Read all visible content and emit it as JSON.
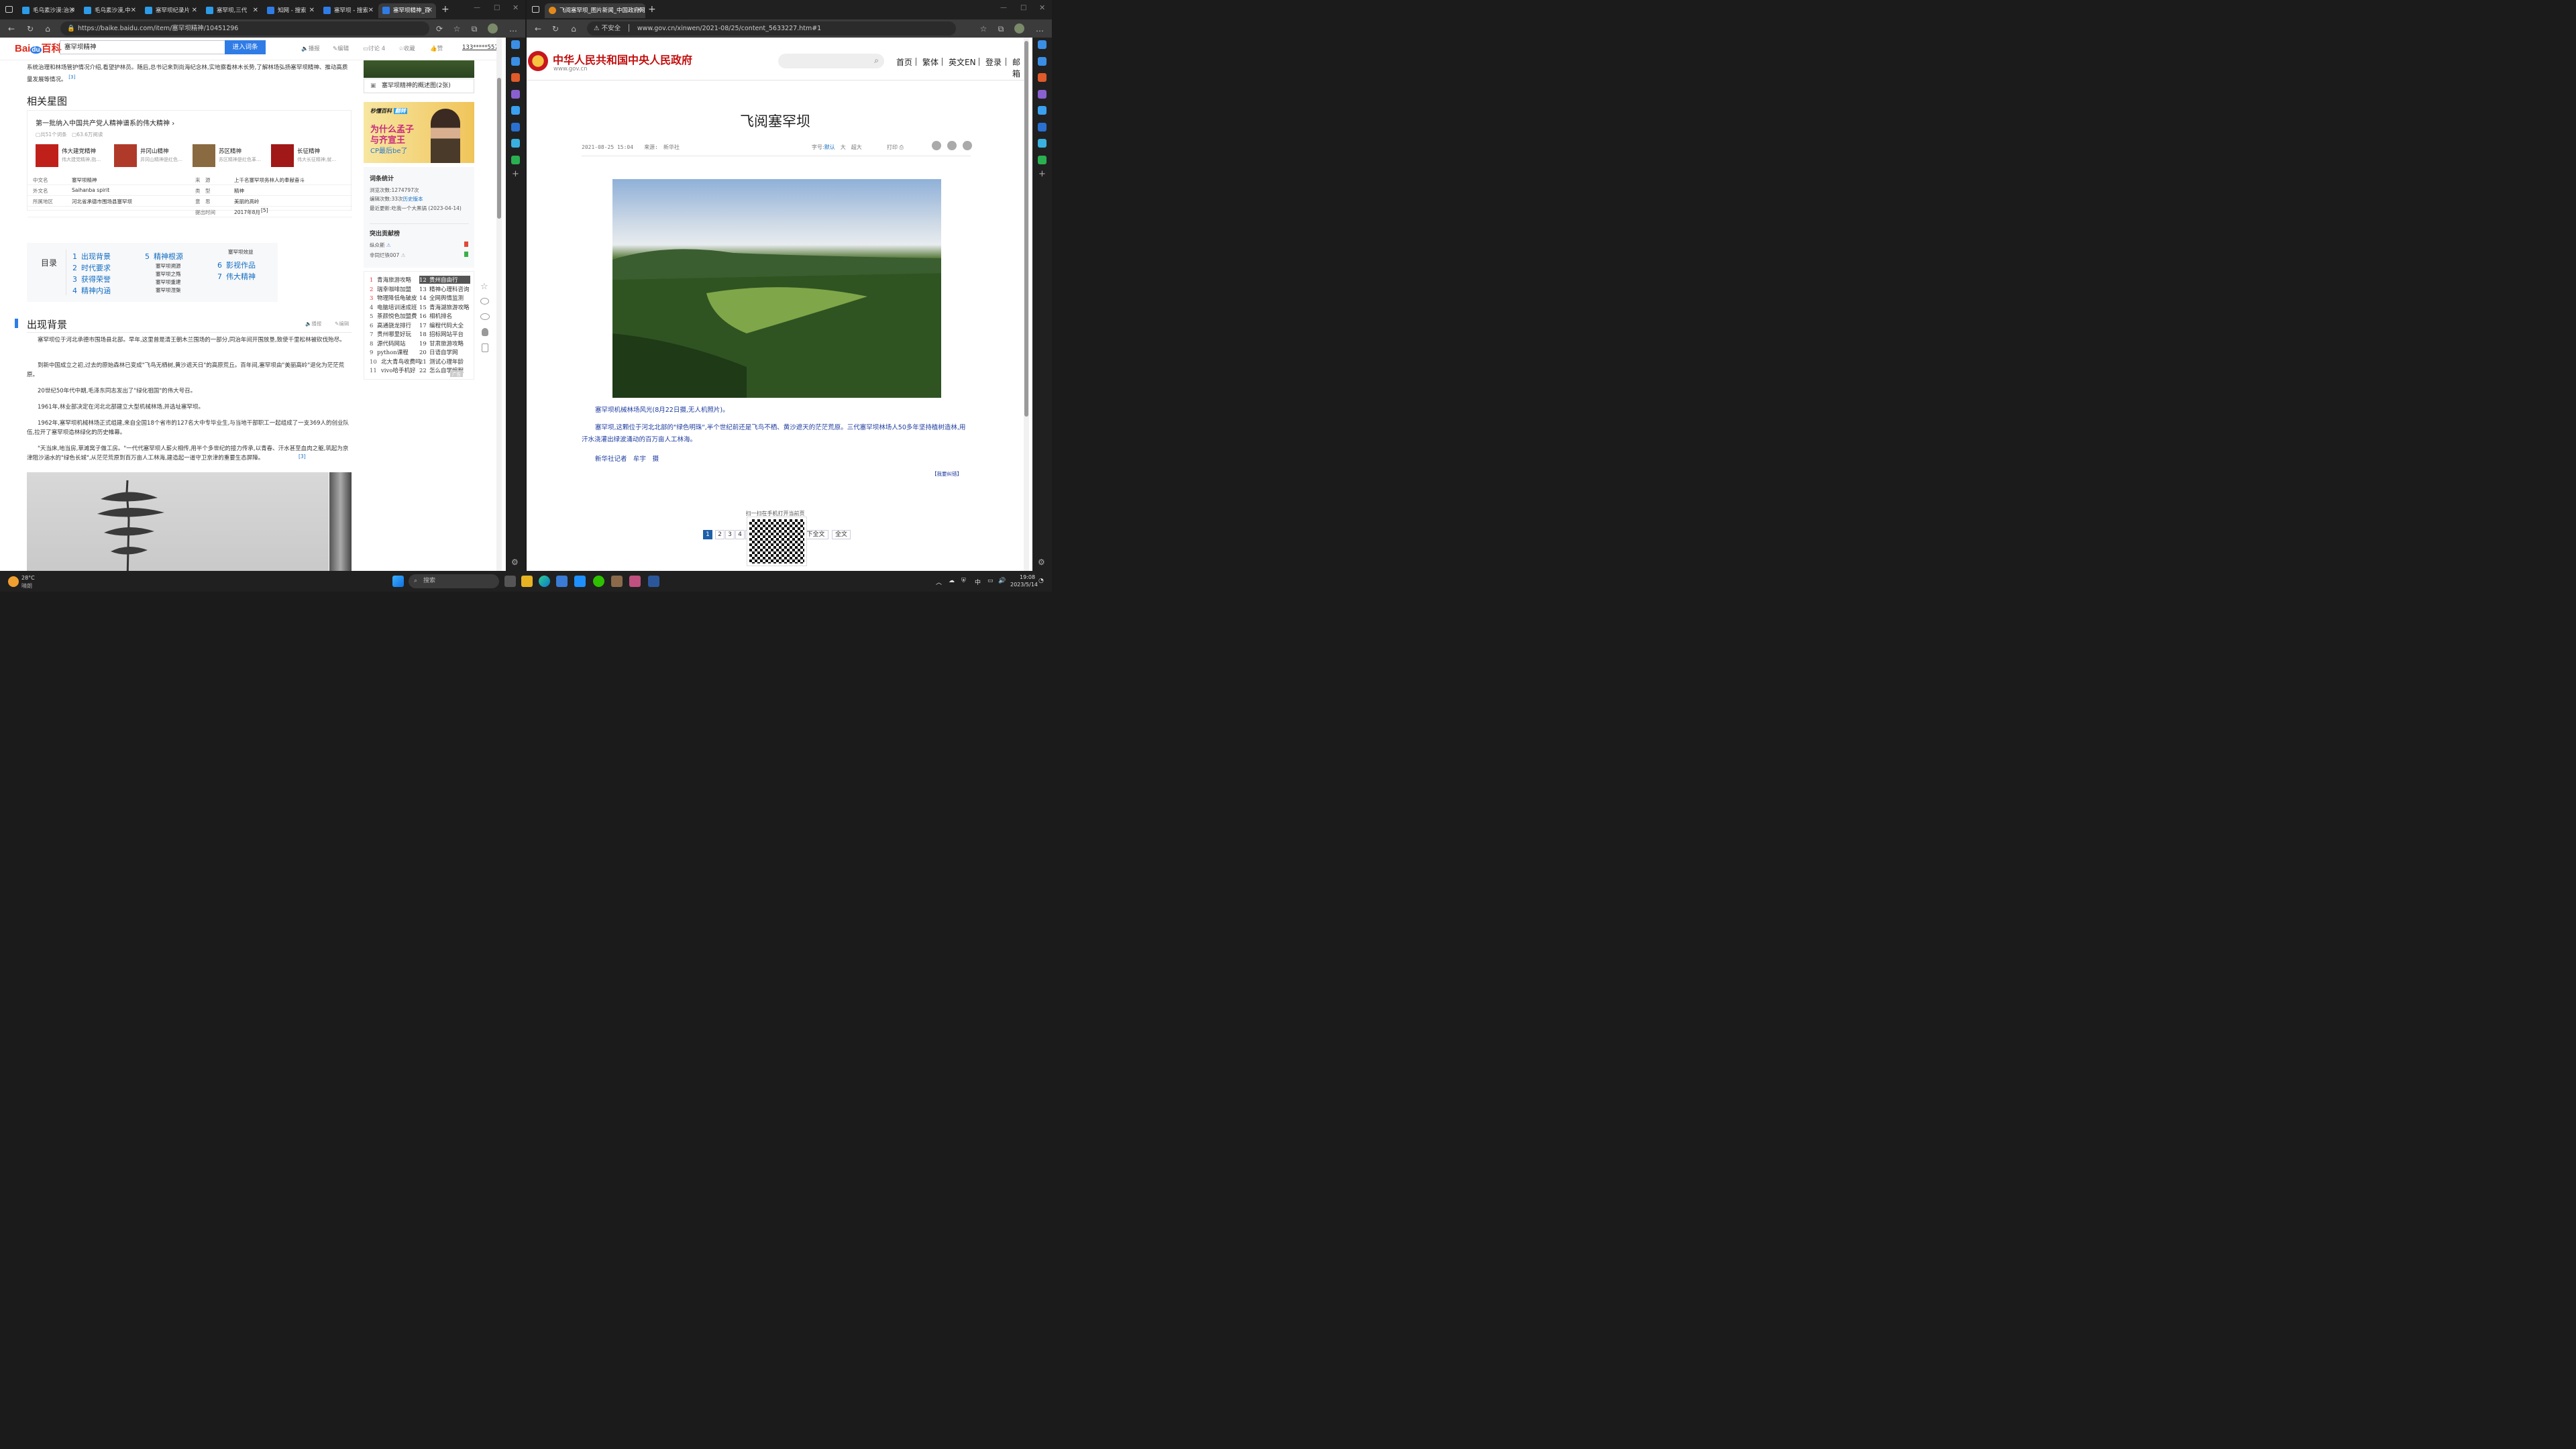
{
  "left_browser": {
    "tabs": [
      {
        "label": "毛乌素沙漠:治沙",
        "active": false
      },
      {
        "label": "毛乌素沙漠,中",
        "active": false
      },
      {
        "label": "塞罕坝纪录片",
        "active": false
      },
      {
        "label": "塞罕坝,三代",
        "active": false
      },
      {
        "label": "知网 - 搜索",
        "active": false
      },
      {
        "label": "塞罕坝 - 搜索",
        "active": false
      },
      {
        "label": "塞罕坝精神_百",
        "active": true
      }
    ],
    "url": "https://baike.baidu.com/item/塞罕坝精神/10451296",
    "baidu": {
      "logo_text": "Bai百科",
      "search_value": "塞罕坝精神",
      "search_button": "进入词条",
      "tools": [
        "播报",
        "编辑",
        "讨论 4",
        "收藏",
        "赞"
      ],
      "user": "133*****557",
      "intro_text": "系统治理和林场管护情况介绍,看望护林员。随后,总书记来到尚海纪念林,实地察看林木长势,了解林场弘扬塞罕坝精神、推动高质量发展等情况。",
      "intro_ref": "[3]",
      "related_title": "相关星图",
      "related_card_title": "第一批纳入中国共产党人精神谱系的伟大精神",
      "related_meta": [
        "共51个词条",
        "63.6万阅读"
      ],
      "stars": [
        {
          "name": "伟大建党精神",
          "desc": "伟大建党精神,指…"
        },
        {
          "name": "井冈山精神",
          "desc": "井冈山精神是红色…"
        },
        {
          "name": "苏区精神",
          "desc": "苏区精神是红色革…"
        },
        {
          "name": "长征精神",
          "desc": "伟大长征精神,就…"
        }
      ],
      "infobox": [
        {
          "k": "中文名",
          "v": "塞罕坝精神",
          "k2": "来　源",
          "v2": "上千名塞罕坝务林人的奉献奋斗"
        },
        {
          "k": "外文名",
          "v": "Saihanba spirit",
          "k2": "类　型",
          "v2": "精神"
        },
        {
          "k": "所属地区",
          "v": "河北省承德市围场县塞罕坝",
          "k2": "意　思",
          "v2": "美丽的高岭"
        },
        {
          "k": "",
          "v": "",
          "k2": "提出时间",
          "v2": "2017年8月"
        }
      ],
      "infobox_ref": "[5]",
      "toc_label": "目录",
      "toc": [
        {
          "n": "1",
          "t": "出现背景"
        },
        {
          "n": "2",
          "t": "时代要求"
        },
        {
          "n": "3",
          "t": "获得荣誉"
        },
        {
          "n": "4",
          "t": "精神内涵"
        },
        {
          "n": "5",
          "t": "精神根源"
        },
        {
          "n": "6",
          "t": "影视作品"
        },
        {
          "n": "7",
          "t": "伟大精神"
        }
      ],
      "toc_subs_5": [
        "塞罕坝溯源",
        "塞罕坝之殇",
        "塞罕坝重建",
        "塞罕坝涅槃"
      ],
      "toc_sub_top": "塞罕坝效益",
      "section_title": "出现背景",
      "section_tools": [
        "播报",
        "编辑"
      ],
      "paragraphs": [
        "塞罕坝位于河北承德市围场县北部。早年,这里曾是清王朝木兰围场的一部分,同治年间开围放垦,致使千里松林被砍伐殆尽。",
        "到新中国成立之初,过去的原始森林已变成\"飞鸟无栖树,黄沙遮天日\"的高原荒丘。百年间,塞罕坝由\"美丽高岭\"退化为茫茫荒原。",
        "20世纪50年代中期,毛泽东同志发出了\"绿化祖国\"的伟大号召。",
        "1961年,林业部决定在河北北部建立大型机械林场,并选址塞罕坝。",
        "1962年,塞罕坝机械林场正式组建,来自全国18个省市的127名大中专毕业生,与当地干部职工一起组成了一支369人的创业队伍,拉开了塞罕坝造林绿化的历史帷幕。",
        "\"天当床,地当房,草滩窝子做工房。\"一代代塞罕坝人薪火相传,用半个多世纪的接力传承,以青春、汗水甚至血肉之躯,筑起为京津阻沙涵水的\"绿色长城\",从茫茫荒原到百万亩人工林海,建造起一道守卫京津的重要生态屏障。"
      ],
      "para_ref": "[3]",
      "album_caption": "塞罕坝精神的概述图(2张)",
      "ad": {
        "brand": "秒懂百科",
        "tag": "翻转",
        "line1": "为什么孟子",
        "line2": "与齐宣王",
        "line3": "CP最后be了"
      },
      "stats": {
        "title": "词条统计",
        "views_label": "浏览次数:",
        "views": "1274797次",
        "edits_label": "编辑次数:",
        "edits": "33次",
        "history": "历史版本",
        "updated_label": "最近更新:",
        "updated": "吃我一个大黑锅 (2023-04-14)"
      },
      "contrib": {
        "title": "突出贡献榜",
        "users": [
          "纵众斯",
          "非同烂铁007"
        ]
      },
      "ranking_left": [
        {
          "n": "1",
          "t": "青海旅游攻略"
        },
        {
          "n": "2",
          "t": "瑞幸咖啡加盟"
        },
        {
          "n": "3",
          "t": "物理降低龟破皮"
        },
        {
          "n": "4",
          "t": "电脑培训速成班"
        },
        {
          "n": "5",
          "t": "茶颜悦色加盟费"
        },
        {
          "n": "6",
          "t": "高通骁龙排行"
        },
        {
          "n": "7",
          "t": "贵州哪里好玩"
        },
        {
          "n": "8",
          "t": "源代码网站"
        },
        {
          "n": "9",
          "t": "python课程"
        },
        {
          "n": "10",
          "t": "北大青鸟收费吗"
        },
        {
          "n": "11",
          "t": "vivo哈手机好"
        }
      ],
      "ranking_right": [
        {
          "n": "12",
          "t": "贵州自由行"
        },
        {
          "n": "13",
          "t": "精神心理科咨询"
        },
        {
          "n": "14",
          "t": "全网舆情监测"
        },
        {
          "n": "15",
          "t": "青海湖旅游攻略"
        },
        {
          "n": "16",
          "t": "相机排名"
        },
        {
          "n": "17",
          "t": "编程代码大全"
        },
        {
          "n": "18",
          "t": "招标网站平台"
        },
        {
          "n": "19",
          "t": "甘肃旅游攻略"
        },
        {
          "n": "20",
          "t": "日语自学网"
        },
        {
          "n": "21",
          "t": "测试心理年龄"
        },
        {
          "n": "22",
          "t": "怎么自学编程"
        }
      ],
      "ranking_tag": "广告"
    }
  },
  "right_browser": {
    "tab_label": "飞阅塞罕坝_图片新闻_中国政府网",
    "insecure": "不安全",
    "url": "www.gov.cn/xinwen/2021-08/25/content_5633227.htm#1",
    "site_name": "中华人民共和国中央人民政府",
    "site_domain": "www.gov.cn",
    "nav": [
      "首页",
      "繁体",
      "英文EN",
      "登录",
      "邮箱"
    ],
    "article_title": "飞阅塞罕坝",
    "meta_date": "2021-08-25 15:04",
    "meta_source_label": "来源:",
    "meta_source": "新华社",
    "font_label": "字号:",
    "font_sizes": [
      "默认",
      "大",
      "超大"
    ],
    "print": "打印",
    "caption": "塞罕坝机械林场风光(8月22日摄,无人机照片)。",
    "body": "塞罕坝,这颗位于河北北部的\"绿色明珠\",半个世纪前还是飞鸟不栖、黄沙遮天的茫茫荒原。三代塞罕坝林场人50多年坚持植树造林,用汗水浇灌出绿波涌动的百万亩人工林海。",
    "reporter": "新华社记者　牟宇　摄",
    "report_error": "【我要纠错】",
    "pages": [
      "1",
      "2",
      "3",
      "4",
      "5",
      "…",
      "14"
    ],
    "rest_label": "余下全文",
    "full_label": "全文",
    "qr_text": "扫一扫在手机打开当前页"
  },
  "taskbar": {
    "weather_temp": "28°C",
    "weather_text": "晴朗",
    "search_placeholder": "搜索",
    "time": "19:08",
    "date": "2023/5/14",
    "ime": "中"
  },
  "colors": {
    "baidu_blue": "#2f7ce6",
    "link": "#136ec2",
    "gov_red": "#c20f0f",
    "tab_dark": "#202020"
  }
}
